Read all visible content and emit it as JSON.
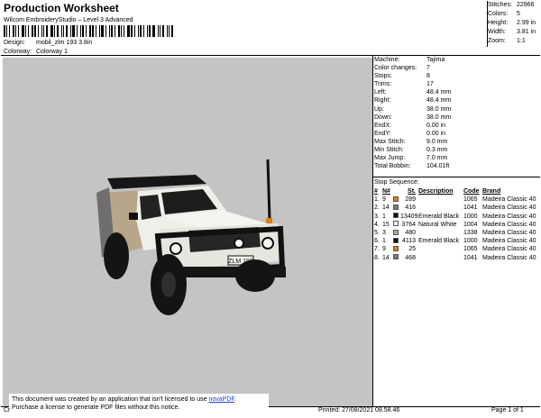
{
  "header": {
    "title": "Production Worksheet",
    "subtitle": "Wilcom EmbroideryStudio – Level 3 Advanced",
    "design_label": "Design:",
    "design_value": "mobil_zlm 193 3.8in",
    "colorway_label": "Colorway:",
    "colorway_value": "Colorway 1"
  },
  "summary": [
    {
      "k": "Stitches:",
      "v": "22966"
    },
    {
      "k": "Colors:",
      "v": "5"
    },
    {
      "k": "Height:",
      "v": "2.99 in"
    },
    {
      "k": "Width:",
      "v": "3.81 in"
    },
    {
      "k": "Zoom:",
      "v": "1:1"
    }
  ],
  "machine_info": [
    {
      "k": "Machine:",
      "v": "Tajima"
    },
    {
      "k": "Color changes:",
      "v": "7"
    },
    {
      "k": "Stops:",
      "v": "8"
    },
    {
      "k": "Trims:",
      "v": "17"
    },
    {
      "k": "Left:",
      "v": "48.4 mm"
    },
    {
      "k": "Right:",
      "v": "48.4 mm"
    },
    {
      "k": "Up:",
      "v": "38.0 mm"
    },
    {
      "k": "Down:",
      "v": "38.0 mm"
    },
    {
      "k": "EndX:",
      "v": "0.00 in"
    },
    {
      "k": "EndY:",
      "v": "0.00 in"
    },
    {
      "k": "Max Stitch:",
      "v": "9.0 mm"
    },
    {
      "k": "Min Stitch:",
      "v": "0.3 mm"
    },
    {
      "k": "Max Jump:",
      "v": "7.0 mm"
    },
    {
      "k": "Total Bobbin:",
      "v": "104.01ft"
    }
  ],
  "stop_sequence": {
    "title": "Stop Sequence:",
    "headers": {
      "n": "#",
      "num": "N#",
      "st": "St.",
      "desc": "Description",
      "code": "Code",
      "brand": "Brand"
    },
    "rows": [
      {
        "n": "1.",
        "num": "9",
        "color": "#e07b1c",
        "st": "289",
        "desc": "",
        "code": "1065",
        "brand": "Madeira Classic 40"
      },
      {
        "n": "2.",
        "num": "14",
        "color": "#7a7a7a",
        "st": "416",
        "desc": "",
        "code": "1041",
        "brand": "Madeira Classic 40"
      },
      {
        "n": "3.",
        "num": "1",
        "color": "#111111",
        "st": "13409",
        "desc": "Emerald Black",
        "code": "1000",
        "brand": "Madeira Classic 40"
      },
      {
        "n": "4.",
        "num": "15",
        "color": "#f2f2ee",
        "st": "3764",
        "desc": "Natural White",
        "code": "1004",
        "brand": "Madeira Classic 40"
      },
      {
        "n": "5.",
        "num": "3",
        "color": "#b8a68a",
        "st": "480",
        "desc": "",
        "code": "1338",
        "brand": "Madeira Classic 40"
      },
      {
        "n": "6.",
        "num": "1",
        "color": "#111111",
        "st": "4113",
        "desc": "Emerald Black",
        "code": "1000",
        "brand": "Madeira Classic 40"
      },
      {
        "n": "7.",
        "num": "9",
        "color": "#e07b1c",
        "st": "25",
        "desc": "",
        "code": "1065",
        "brand": "Madeira Classic 40"
      },
      {
        "n": "8.",
        "num": "14",
        "color": "#7a7a7a",
        "st": "468",
        "desc": "",
        "code": "1041",
        "brand": "Madeira Classic 40"
      }
    ]
  },
  "design": {
    "plate_text": "ZLM 193"
  },
  "notice": {
    "line1": "This document was created by an application that isn't licensed to use",
    "link": "novaPDF",
    "line2": "Purchase a license to generate PDF files without this notice."
  },
  "footer": {
    "left": "Cr",
    "printed": "Printed: 27/08/2021 08.58.46",
    "page": "Page 1 of 1"
  }
}
